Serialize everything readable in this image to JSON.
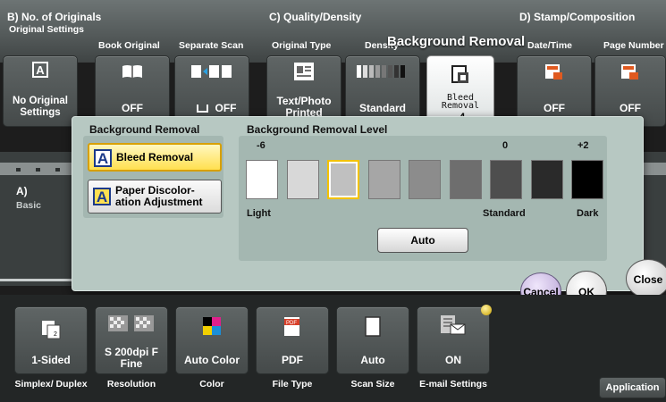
{
  "header": {
    "groups": [
      {
        "label": "B)  No. of Originals"
      },
      {
        "label": "C)  Quality/Density"
      },
      {
        "label": "D)  Stamp/Composition"
      }
    ],
    "subs": [
      "Original Settings",
      "Book Original",
      "Separate Scan",
      "Original Type",
      "Density",
      "Date/Time",
      "Page Number"
    ]
  },
  "top_tiles": [
    {
      "label": "No Original Settings"
    },
    {
      "label": "OFF"
    },
    {
      "label": "OFF"
    },
    {
      "label": "Text/Photo Printed"
    },
    {
      "label": "Standard"
    },
    {
      "label": "Bleed Removal",
      "value": "-4"
    },
    {
      "label": "OFF"
    },
    {
      "label": "OFF"
    }
  ],
  "left_side": {
    "label": "A)",
    "basic": "Basic"
  },
  "dialog": {
    "title": "Background Removal",
    "section_left": "Background Removal",
    "options": [
      {
        "label": "Bleed Removal",
        "selected": true
      },
      {
        "label": "Paper Discolor-ation Adjustment",
        "selected": false
      }
    ],
    "section_right": "Background Removal Level",
    "level_minus": "-6",
    "level_zero": "0",
    "level_plus": "+2",
    "swatches": [
      "#ffffff",
      "#d8d8d8",
      "#c0c0c0",
      "#a6a6a6",
      "#8c8c8c",
      "#6e6e6e",
      "#4e4e4e",
      "#2a2a2a",
      "#000000"
    ],
    "selected_index": 2,
    "light": "Light",
    "standard": "Standard",
    "dark": "Dark",
    "auto": "Auto"
  },
  "actions": {
    "cancel": "Cancel",
    "ok": "OK",
    "close": "Close"
  },
  "bottom_tiles": [
    {
      "label": "1-Sided",
      "sub": "Simplex/ Duplex"
    },
    {
      "label": "S 200dpi F Fine",
      "sub": "Resolution"
    },
    {
      "label": "Auto Color",
      "sub": "Color"
    },
    {
      "label": "PDF",
      "sub": "File Type"
    },
    {
      "label": "Auto",
      "sub": "Scan Size"
    },
    {
      "label": "ON",
      "sub": "E-mail Settings"
    }
  ],
  "application": "Application",
  "colors": {
    "accent_yellow": "#ffe050",
    "panel": "#b7c8c2",
    "cancel": "#c9b8df",
    "ok": "#ececec"
  }
}
